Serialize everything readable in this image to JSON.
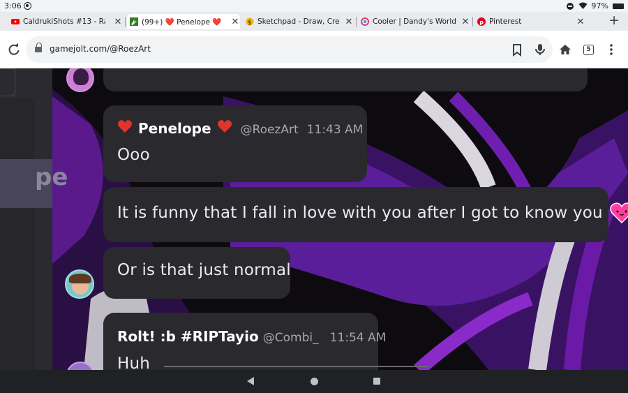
{
  "status_bar": {
    "time": "3:06",
    "battery": "97%"
  },
  "tabs": [
    {
      "title": "CaldrukiShots #13 - Random",
      "favicon": "youtube-icon",
      "active": false
    },
    {
      "title": "(99+) ❤️ Penelope ❤️ (@Ro",
      "favicon": "gamejolt-icon",
      "active": true
    },
    {
      "title": "Sketchpad - Draw, Create, Sh",
      "favicon": "sketchpad-icon",
      "active": false
    },
    {
      "title": "Cooler | Dandy's World Wiki",
      "favicon": "fandom-icon",
      "active": false
    },
    {
      "title": "Pinterest",
      "favicon": "pinterest-icon",
      "active": false
    }
  ],
  "toolbar": {
    "url": "gamejolt.com/@RoezArt",
    "tab_count": "5"
  },
  "messages": [
    {
      "name": "Penelope",
      "handle": "@RoezArt",
      "time": "11:43 AM",
      "text": "Ooo"
    },
    {
      "text": "It is funny that I fall in love with you after I got to know you"
    },
    {
      "text": "Or is that just normal"
    },
    {
      "name": "Rolt! :b #RIPTayio",
      "handle": "@Combi_",
      "time": "11:54 AM",
      "text": "Huh"
    }
  ],
  "left_panel": {
    "partial_text": "pe"
  },
  "colors": {
    "bubble": "#2a292e",
    "accent_purple": "#5a1a8c",
    "heart": "#e0352b",
    "pink_emoji": "#ff3fa0"
  }
}
